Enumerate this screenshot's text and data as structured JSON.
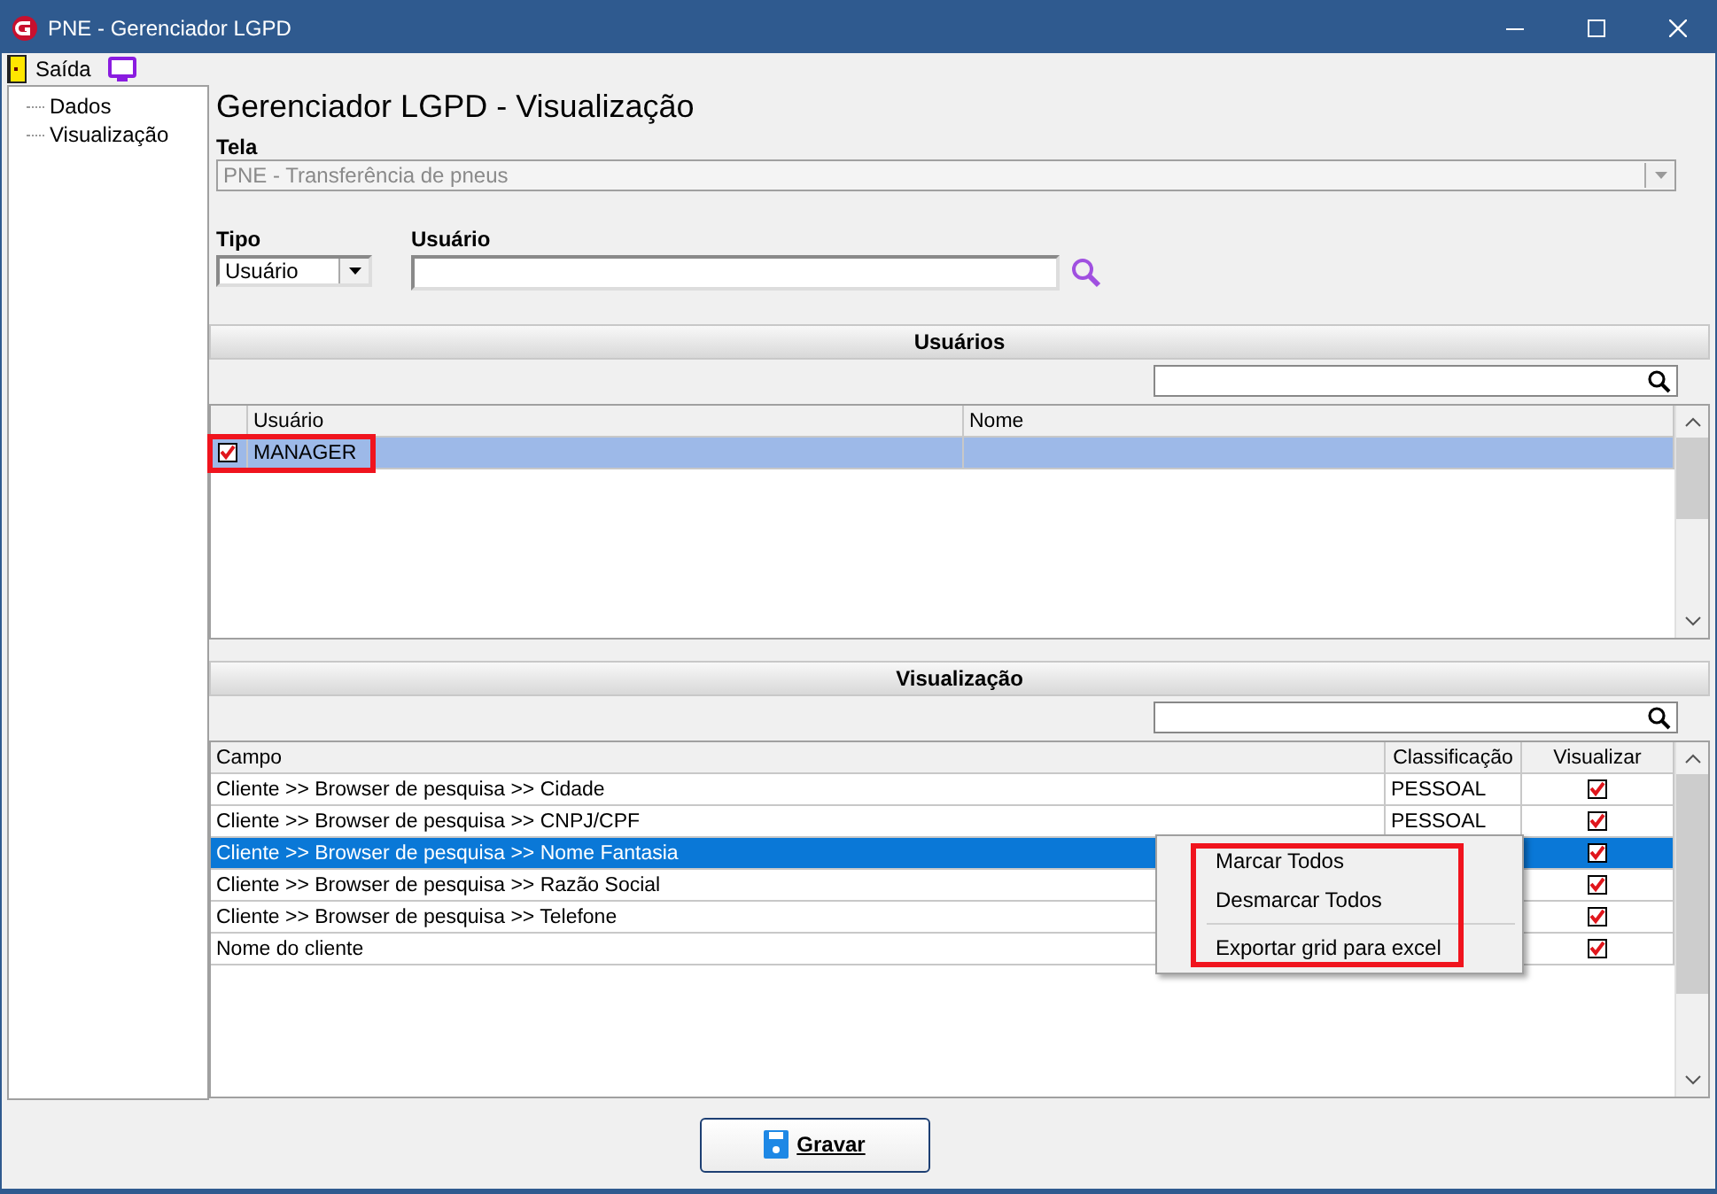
{
  "window": {
    "title": "PNE - Gerenciador LGPD"
  },
  "toolbar": [
    {
      "label": "Saída",
      "kind": "exit"
    },
    {
      "kind": "monitor"
    }
  ],
  "tree": {
    "items": [
      {
        "label": "Dados"
      },
      {
        "label": "Visualização"
      }
    ]
  },
  "heading": "Gerenciador LGPD - Visualização",
  "tela": {
    "label": "Tela",
    "value": "PNE - Transferência de pneus",
    "disabled": true
  },
  "tipo": {
    "label": "Tipo",
    "value": "Usuário"
  },
  "usuario": {
    "label": "Usuário"
  },
  "users_section": {
    "title": "Usuários",
    "columns": [
      "Usuário",
      "Nome"
    ],
    "rows": [
      {
        "checked": true,
        "selected": true,
        "cells": [
          "MANAGER",
          ""
        ]
      }
    ]
  },
  "view_section": {
    "title": "Visualização",
    "columns": [
      "Campo",
      "Classificação",
      "Visualizar"
    ],
    "rows": [
      {
        "campo": "Cliente >> Browser de pesquisa >> Cidade",
        "classificacao": "PESSOAL",
        "visualizar": true,
        "selected": false
      },
      {
        "campo": "Cliente >> Browser de pesquisa >> CNPJ/CPF",
        "classificacao": "PESSOAL",
        "visualizar": true,
        "selected": false
      },
      {
        "campo": "Cliente >> Browser de pesquisa >> Nome Fantasia",
        "visualizar": true,
        "selected": true
      },
      {
        "campo": "Cliente >> Browser de pesquisa >> Razão Social",
        "visualizar": true,
        "selected": false
      },
      {
        "campo": "Cliente >> Browser de pesquisa >> Telefone",
        "visualizar": true,
        "selected": false
      },
      {
        "campo": "Nome do cliente",
        "visualizar": true,
        "selected": false
      }
    ]
  },
  "context_menu": {
    "items": [
      {
        "label": "Marcar Todos",
        "kind": "item"
      },
      {
        "label": "Desmarcar Todos",
        "kind": "item"
      },
      {
        "kind": "separator"
      },
      {
        "label": "Exportar grid para excel",
        "kind": "item"
      }
    ]
  },
  "save_button": {
    "label": "Gravar"
  }
}
